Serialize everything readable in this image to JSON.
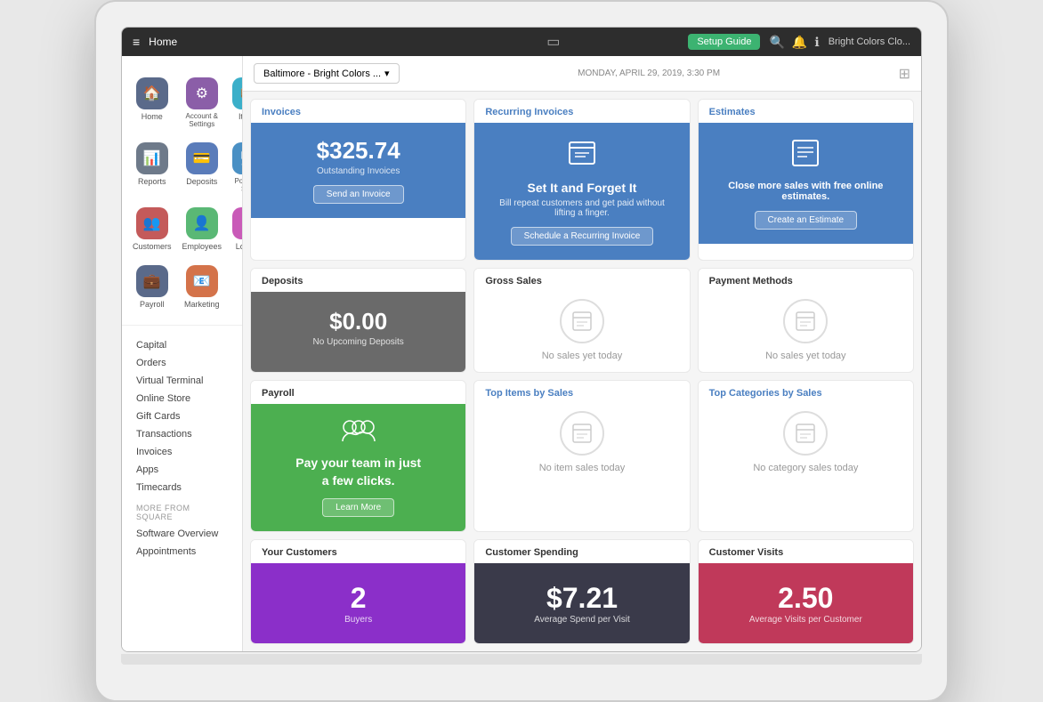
{
  "topbar": {
    "hamburger": "≡",
    "title": "Home",
    "monitor_icon": "⬜",
    "setup_guide": "Setup Guide",
    "search_icon": "🔍",
    "bell_icon": "🔔",
    "info_icon": "ℹ",
    "user": "Bright Colors Clo..."
  },
  "location": {
    "label": "Baltimore - Bright Colors ..."
  },
  "date": "MONDAY, APRIL 29, 2019, 3:30 PM",
  "sidebar": {
    "icons": [
      {
        "label": "Home",
        "icon": "🏠",
        "cls": "icon-home"
      },
      {
        "label": "Account & Settings",
        "icon": "⚙",
        "cls": "icon-account"
      },
      {
        "label": "Items",
        "icon": "📦",
        "cls": "icon-items"
      },
      {
        "label": "Reports",
        "icon": "📊",
        "cls": "icon-reports"
      },
      {
        "label": "Deposits",
        "icon": "💳",
        "cls": "icon-deposits"
      },
      {
        "label": "Points of Sale",
        "icon": "🖥",
        "cls": "icon-pos"
      },
      {
        "label": "Customers",
        "icon": "👥",
        "cls": "icon-customers"
      },
      {
        "label": "Employees",
        "icon": "👤",
        "cls": "icon-employees"
      },
      {
        "label": "Loyalty",
        "icon": "★",
        "cls": "icon-loyalty"
      },
      {
        "label": "Payroll",
        "icon": "💼",
        "cls": "icon-payroll"
      },
      {
        "label": "Marketing",
        "icon": "📧",
        "cls": "icon-marketing"
      }
    ],
    "links": [
      "Capital",
      "Orders",
      "Virtual Terminal",
      "Online Store",
      "Gift Cards",
      "Transactions",
      "Invoices",
      "Apps",
      "Timecards"
    ],
    "more_section_label": "MORE FROM SQUARE",
    "more_links": [
      "Software Overview",
      "Appointments"
    ]
  },
  "cards": {
    "invoices": {
      "header": "Invoices",
      "amount": "$325.74",
      "sublabel": "Outstanding Invoices",
      "button": "Send an Invoice"
    },
    "recurring": {
      "header": "Recurring Invoices",
      "icon": "📄",
      "title": "Set It and Forget It",
      "desc": "Bill repeat customers and get paid without lifting a finger.",
      "button": "Schedule a Recurring Invoice"
    },
    "estimates": {
      "header": "Estimates",
      "icon": "📋",
      "desc": "Close more sales with free online estimates.",
      "button": "Create an Estimate"
    },
    "deposits": {
      "header": "Deposits",
      "amount": "$0.00",
      "sublabel": "No Upcoming Deposits"
    },
    "gross_sales": {
      "header": "Gross Sales",
      "no_sales_text": "No sales yet today"
    },
    "payment_methods": {
      "header": "Payment Methods",
      "no_sales_text": "No sales yet today"
    },
    "payroll": {
      "header": "Payroll",
      "icon": "👥",
      "text_line1": "Pay your team in just",
      "text_line2": "a few clicks.",
      "button": "Learn More"
    },
    "top_items": {
      "header": "Top Items by Sales",
      "no_sales_text": "No item sales today"
    },
    "top_categories": {
      "header": "Top Categories by Sales",
      "no_sales_text": "No category sales today"
    },
    "customers": {
      "header": "Your Customers",
      "number": "2",
      "label": "Buyers"
    },
    "spending": {
      "header": "Customer Spending",
      "amount": "$7.21",
      "label": "Average Spend per Visit"
    },
    "visits": {
      "header": "Customer Visits",
      "number": "2.50",
      "label": "Average Visits per Customer"
    }
  }
}
